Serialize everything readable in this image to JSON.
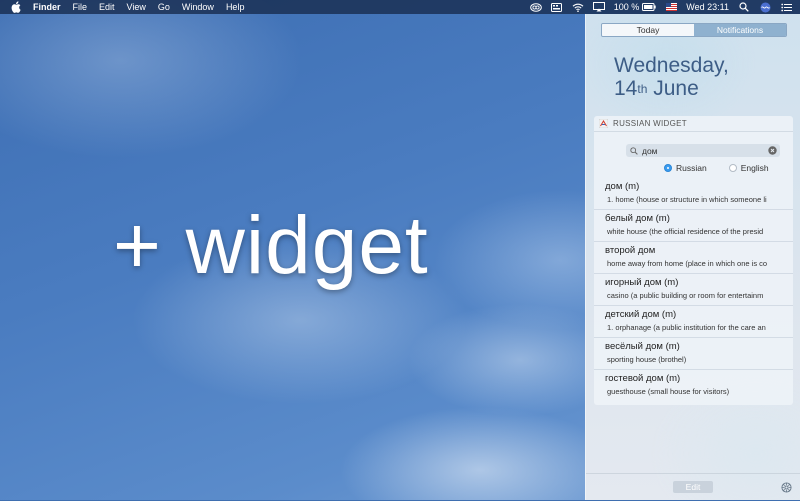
{
  "menubar": {
    "items": [
      "Finder",
      "File",
      "Edit",
      "View",
      "Go",
      "Window",
      "Help"
    ],
    "battery": "100 %",
    "clock": "Wed 23:11"
  },
  "overlay_text": "+ widget",
  "notification_center": {
    "tabs": [
      "Today",
      "Notifications"
    ],
    "date": {
      "weekday": "Wednesday,",
      "day_number": "14",
      "day_suffix": "th",
      "month": "June"
    },
    "widget": {
      "title": "RUSSIAN WIDGET",
      "search_value": "дом",
      "radio_options": [
        "Russian",
        "English"
      ],
      "selected_language": "Russian",
      "results": [
        {
          "term": "дом (m)",
          "definition": "1. home (house or structure in which someone li"
        },
        {
          "term": "белый дом (m)",
          "definition": "white house (the official residence of the presid"
        },
        {
          "term": "второй дом",
          "definition": "home away from home (place in which one is co"
        },
        {
          "term": "игорный дом (m)",
          "definition": "casino (a public building or room for entertainm"
        },
        {
          "term": "детский дом (m)",
          "definition": "1. orphanage (a public institution for the care an"
        },
        {
          "term": "весёлый дом (m)",
          "definition": "sporting house (brothel)"
        },
        {
          "term": "гостевой дом (m)",
          "definition": "guesthouse (small house for visitors)"
        }
      ]
    },
    "edit_label": "Edit"
  },
  "colors": {
    "accent": "#3a9cf0",
    "date_text": "#3d5d86",
    "menubar_bg": "#192d50"
  },
  "icons": [
    "apple-icon",
    "creative-cloud-icon",
    "keyboard-icon",
    "wifi-icon",
    "airplay-icon",
    "battery-icon",
    "flag-icon",
    "search-icon",
    "siri-icon",
    "list-icon",
    "widget-app-icon",
    "magnifier-icon",
    "clear-icon",
    "settings-gear-icon"
  ]
}
